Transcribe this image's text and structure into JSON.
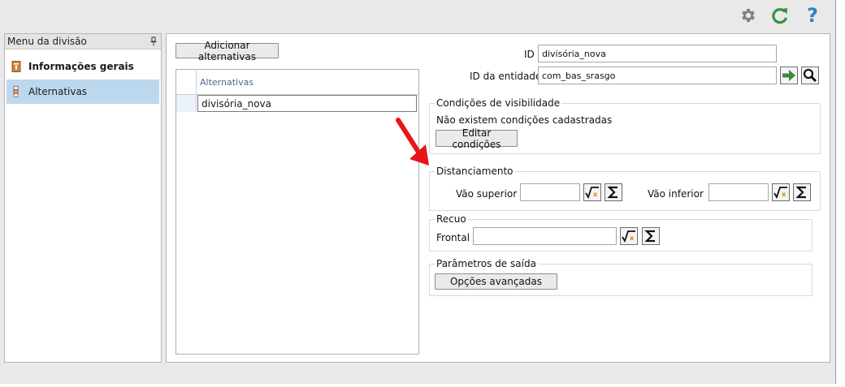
{
  "toolbar": {
    "icons": [
      "gear-icon",
      "refresh-icon",
      "help-icon"
    ],
    "help_glyph": "?",
    "colors": {
      "gear": "#808080",
      "refresh": "#3e8e41",
      "help": "#2a87c8"
    }
  },
  "sidebar": {
    "header": "Menu da divisão",
    "items": [
      {
        "label": "Informações gerais",
        "icon": "info-icon",
        "selected": false
      },
      {
        "label": "Alternativas",
        "icon": "alternatives-icon",
        "selected": true
      }
    ]
  },
  "alternatives": {
    "add_button": "Adicionar alternativas",
    "column_header": "Alternativas",
    "rows": [
      "divisória_nova"
    ]
  },
  "form": {
    "id_label": "ID",
    "id_value": "divisória_nova",
    "entity_label": "ID da entidade",
    "entity_value": "com_bas_srasgo",
    "visibility": {
      "title": "Condições de visibilidade",
      "status": "Não existem condições cadastradas",
      "edit_button": "Editar condições"
    },
    "spacing": {
      "title": "Distanciamento",
      "upper_label": "Vão superior",
      "upper_value": "",
      "lower_label": "Vão inferior",
      "lower_value": ""
    },
    "recess": {
      "title": "Recuo",
      "front_label": "Frontal",
      "front_value": ""
    },
    "output": {
      "title": "Parâmetros de saída",
      "advanced_button": "Opções avançadas"
    }
  },
  "annotation": {
    "arrow_color": "#e8141c"
  }
}
